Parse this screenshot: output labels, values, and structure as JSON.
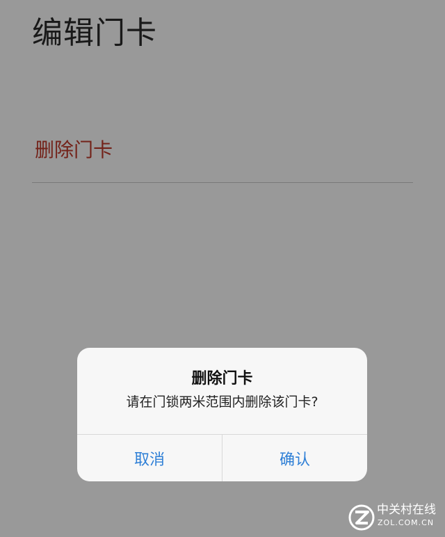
{
  "page": {
    "title": "编辑门卡",
    "delete_label": "删除门卡"
  },
  "dialog": {
    "title": "删除门卡",
    "message": "请在门锁两米范围内删除该门卡?",
    "cancel_label": "取消",
    "confirm_label": "确认"
  },
  "watermark": {
    "brand_cn": "中关村在线",
    "brand_en": "ZOL.COM.CN"
  },
  "colors": {
    "destructive": "#c0392b",
    "dialog_action": "#2e7fd6",
    "dim_overlay": "rgba(0,0,0,0.40)"
  }
}
